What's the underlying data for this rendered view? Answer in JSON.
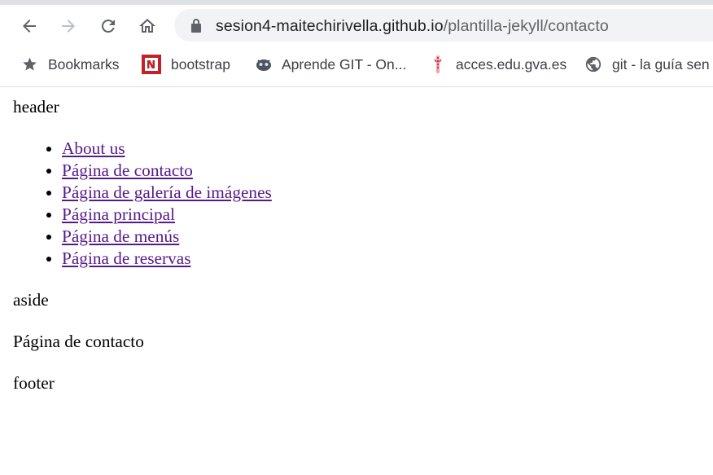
{
  "browser": {
    "url_host": "sesion4-maitechirivella.github.io",
    "url_path": "/plantilla-jekyll/contacto",
    "bookmarks": [
      {
        "label": "Bookmarks",
        "icon": "star-icon"
      },
      {
        "label": "bootstrap",
        "icon": "bootstrap-favicon-icon"
      },
      {
        "label": "Aprende GIT - On...",
        "icon": "git-course-favicon-icon"
      },
      {
        "label": "acces.edu.gva.es",
        "icon": "gva-favicon-icon"
      },
      {
        "label": "git - la guía sen",
        "icon": "globe-icon"
      }
    ]
  },
  "page": {
    "header": "header",
    "nav_links": [
      "About us",
      "Página de contacto",
      "Página de galería de imágenes",
      "Página principal",
      "Página de menús",
      "Página de reservas"
    ],
    "aside": "aside",
    "main": "Página de contacto",
    "footer": "footer"
  },
  "colors": {
    "link_visited": "#551a8b",
    "omnibox_bg": "#f1f3f4",
    "tab_strip": "#dee1e6"
  }
}
